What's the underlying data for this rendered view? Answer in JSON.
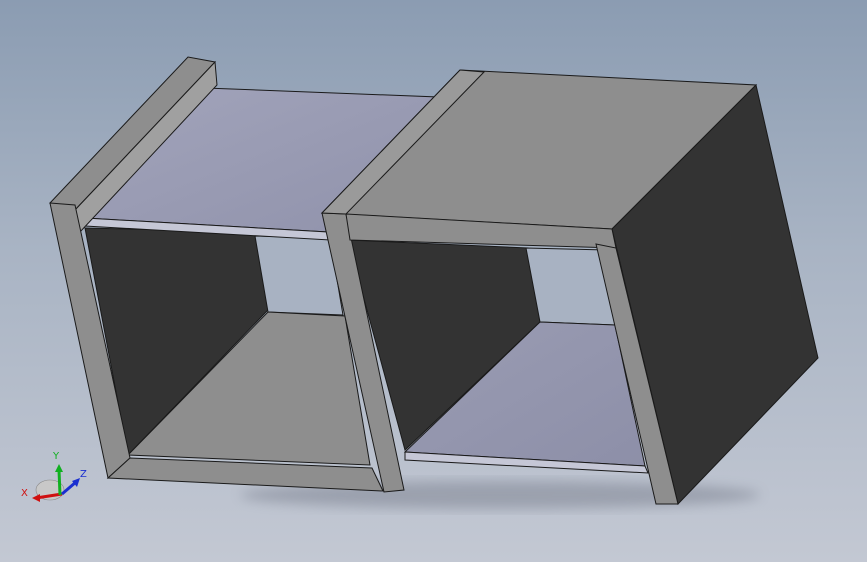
{
  "viewport": {
    "background_top": "#8b9cb2",
    "background_bottom": "#c3c8d3"
  },
  "model": {
    "face_colors": {
      "light_gray": "#8e8e8e",
      "dark_gray": "#333333",
      "panel_blue": "#9b9db4",
      "edge": "#1a1a1a"
    }
  },
  "triad": {
    "x_label": "X",
    "y_label": "Y",
    "z_label": "Z",
    "x_color": "#d01010",
    "y_color": "#10b020",
    "z_color": "#1a2fd0"
  }
}
